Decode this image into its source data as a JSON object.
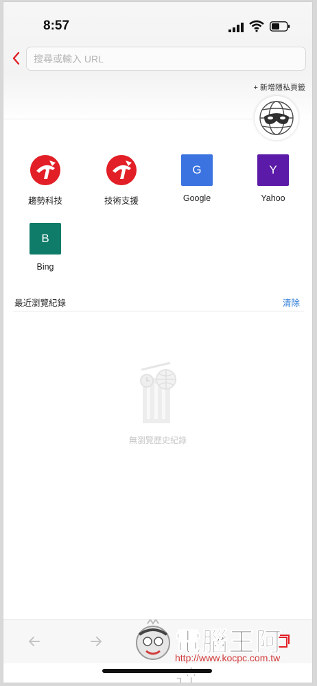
{
  "status_bar": {
    "time": "8:57"
  },
  "address_bar": {
    "placeholder": "搜尋或輸入 URL"
  },
  "new_private_tab": "+ 新增隱私頁籤",
  "shortcuts": [
    {
      "label": "趨勢科技",
      "icon": "trend-micro-logo-icon"
    },
    {
      "label": "技術支援",
      "icon": "trend-micro-logo-icon"
    },
    {
      "label": "Google",
      "letter": "G",
      "color": "#3b73e0"
    },
    {
      "label": "Yahoo",
      "letter": "Y",
      "color": "#5b1aa8"
    },
    {
      "label": "Bing",
      "letter": "B",
      "color": "#0f7b69"
    }
  ],
  "recent": {
    "title": "最近瀏覽紀錄",
    "clear_label": "清除",
    "empty_text": "無瀏覽歷史紀錄"
  },
  "watermark": {
    "title": "電腦王阿達",
    "url": "http://www.kocpc.com.tw"
  },
  "colors": {
    "accent_red": "#e21f26",
    "link_blue": "#2a7ad5"
  }
}
